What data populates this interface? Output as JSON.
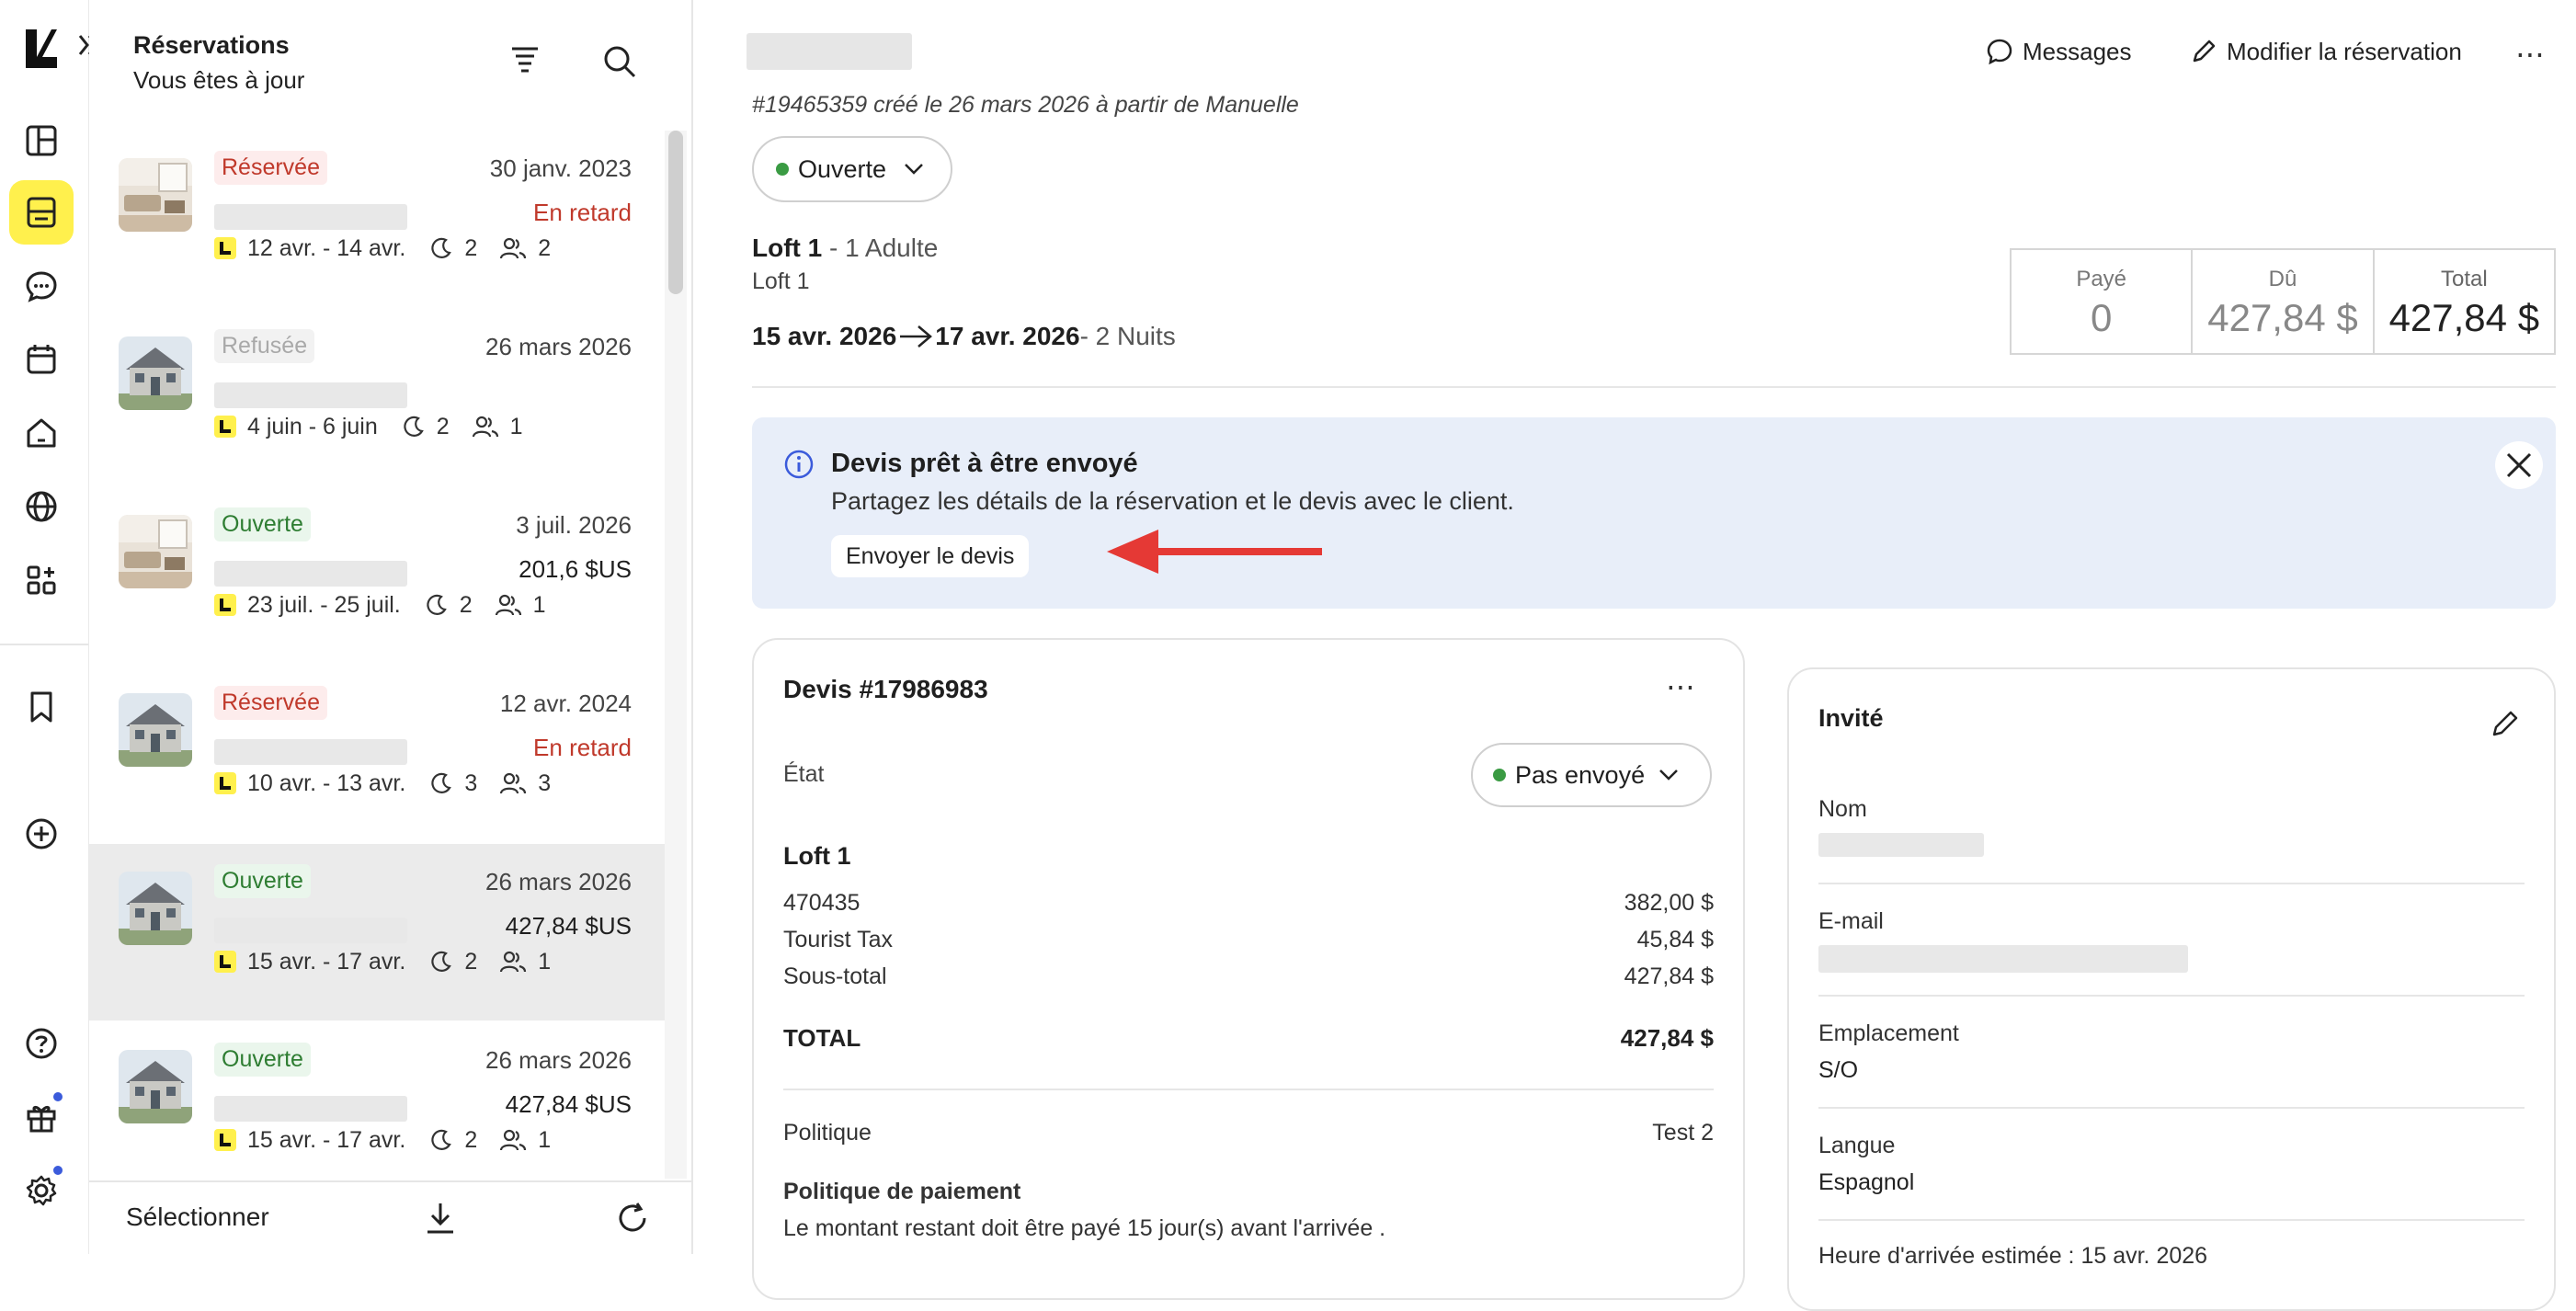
{
  "sidebar_header": {
    "title": "Réservations",
    "subtitle": "Vous êtes à jour"
  },
  "reservations": [
    {
      "status": "Réservée",
      "status_kind": "reserved",
      "date": "30 janv. 2023",
      "secondary": "En retard",
      "secondary_kind": "late",
      "dates_range": "12 avr. - 14 avr.",
      "nights": "2",
      "guests": "2",
      "thumb": "interior"
    },
    {
      "status": "Refusée",
      "status_kind": "refused",
      "date": "26 mars 2026",
      "secondary": "",
      "secondary_kind": "",
      "dates_range": "4 juin - 6 juin",
      "nights": "2",
      "guests": "1",
      "thumb": "house"
    },
    {
      "status": "Ouverte",
      "status_kind": "open",
      "date": "3 juil. 2026",
      "secondary": "201,6 $US",
      "secondary_kind": "amount",
      "dates_range": "23 juil. - 25 juil.",
      "nights": "2",
      "guests": "1",
      "thumb": "interior"
    },
    {
      "status": "Réservée",
      "status_kind": "reserved",
      "date": "12 avr. 2024",
      "secondary": "En retard",
      "secondary_kind": "late",
      "dates_range": "10 avr. - 13 avr.",
      "nights": "3",
      "guests": "3",
      "thumb": "house"
    },
    {
      "status": "Ouverte",
      "status_kind": "open",
      "date": "26 mars 2026",
      "secondary": "427,84 $US",
      "secondary_kind": "amount",
      "dates_range": "15 avr. - 17 avr.",
      "nights": "2",
      "guests": "1",
      "thumb": "house",
      "selected": true
    },
    {
      "status": "Ouverte",
      "status_kind": "open",
      "date": "26 mars 2026",
      "secondary": "427,84 $US",
      "secondary_kind": "amount",
      "dates_range": "15 avr. - 17 avr.",
      "nights": "2",
      "guests": "1",
      "thumb": "house"
    }
  ],
  "list_footer": {
    "select_label": "Sélectionner"
  },
  "header_actions": {
    "messages": "Messages",
    "edit": "Modifier la réservation"
  },
  "booking": {
    "meta": "#19465359 créé le 26 mars 2026 à partir de Manuelle",
    "status": "Ouverte",
    "unit_name": "Loft 1",
    "unit_guests": " - 1 Adulte",
    "unit_sub": "Loft 1",
    "checkin": "15 avr. 2026",
    "checkout": "17 avr. 2026",
    "nights": " - 2 Nuits"
  },
  "payment": {
    "paid_label": "Payé",
    "paid_value": "0",
    "due_label": "Dû",
    "due_value": "427,84 $",
    "total_label": "Total",
    "total_value": "427,84 $"
  },
  "alert": {
    "title": "Devis prêt à être envoyé",
    "text": "Partagez les détails de la réservation et le devis avec le client.",
    "button": "Envoyer le devis"
  },
  "quote": {
    "title": "Devis #17986983",
    "state_label": "État",
    "state_value": "Pas envoyé",
    "unit": "Loft 1",
    "lines": [
      {
        "label": "470435",
        "amount": "382,00 $"
      },
      {
        "label": "Tourist Tax",
        "amount": "45,84 $"
      },
      {
        "label": "Sous-total",
        "amount": "427,84 $"
      }
    ],
    "total_label": "TOTAL",
    "total_value": "427,84 $",
    "policy_label": "Politique",
    "policy_value": "Test 2",
    "payment_policy_title": "Politique de paiement",
    "payment_policy_text": "Le montant restant doit être payé 15 jour(s) avant l'arrivée ."
  },
  "guest": {
    "title": "Invité",
    "name_label": "Nom",
    "email_label": "E-mail",
    "location_label": "Emplacement",
    "location_value": "S/O",
    "language_label": "Langue",
    "language_value": "Espagnol",
    "eta_label": "Heure d'arrivée estimée : 15 avr. 2026"
  },
  "colors": {
    "accent_yellow": "#fff04d",
    "reserved_red": "#c0392b",
    "open_green": "#2e7d32",
    "alert_bg": "#e8eef9",
    "arrow_red": "#e53935"
  }
}
